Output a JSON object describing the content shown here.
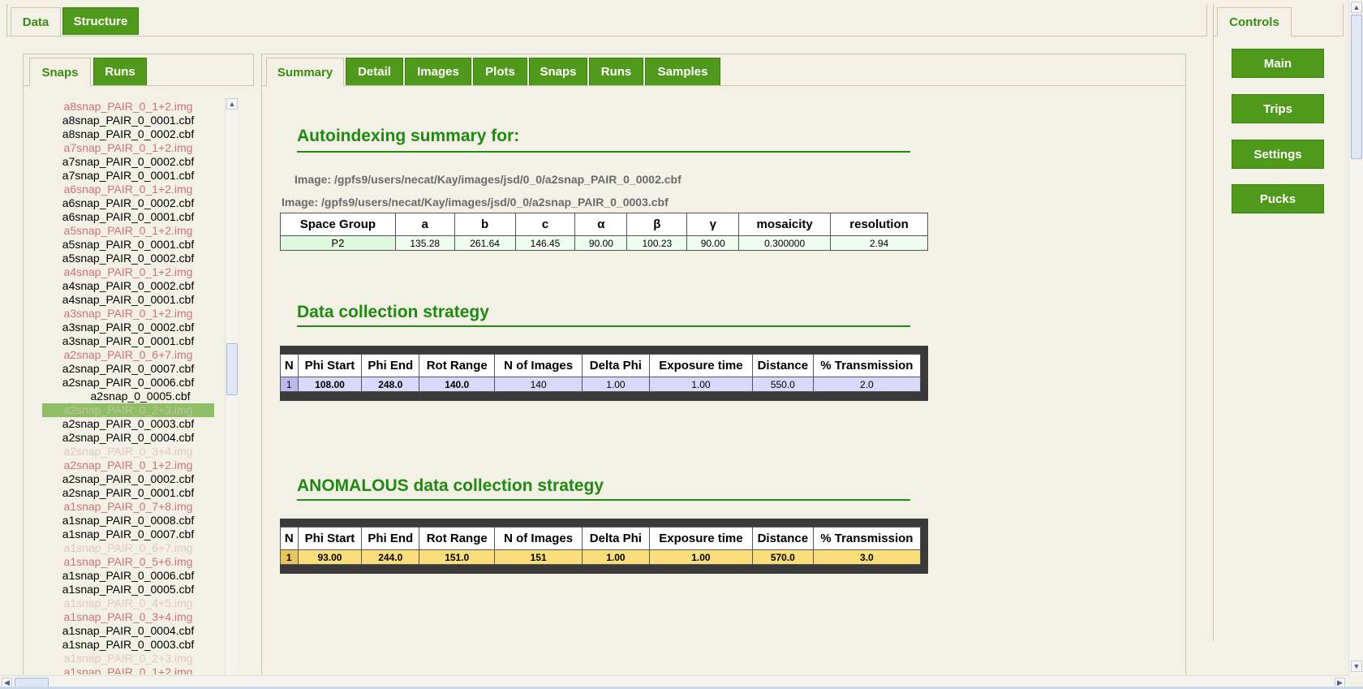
{
  "top_tabs": [
    {
      "label": "Data",
      "active": true
    },
    {
      "label": "Structure",
      "active": false
    }
  ],
  "left_tabs": [
    {
      "label": "Snaps",
      "active": true
    },
    {
      "label": "Runs",
      "active": false
    }
  ],
  "main_tabs": [
    {
      "label": "Summary",
      "active": true
    },
    {
      "label": "Detail",
      "active": false
    },
    {
      "label": "Images",
      "active": false
    },
    {
      "label": "Plots",
      "active": false
    },
    {
      "label": "Snaps",
      "active": false
    },
    {
      "label": "Runs",
      "active": false
    },
    {
      "label": "Samples",
      "active": false
    }
  ],
  "controls": {
    "tab_label": "Controls",
    "buttons": [
      "Main",
      "Trips",
      "Settings",
      "Pucks"
    ]
  },
  "snap_list": [
    {
      "name": "a8snap_PAIR_0_1+2.img",
      "style": "pink"
    },
    {
      "name": "a8snap_PAIR_0_0001.cbf",
      "style": "norm"
    },
    {
      "name": "a8snap_PAIR_0_0002.cbf",
      "style": "norm"
    },
    {
      "name": "a7snap_PAIR_0_1+2.img",
      "style": "pink"
    },
    {
      "name": "a7snap_PAIR_0_0002.cbf",
      "style": "norm"
    },
    {
      "name": "a7snap_PAIR_0_0001.cbf",
      "style": "norm"
    },
    {
      "name": "a6snap_PAIR_0_1+2.img",
      "style": "pink"
    },
    {
      "name": "a6snap_PAIR_0_0002.cbf",
      "style": "norm"
    },
    {
      "name": "a6snap_PAIR_0_0001.cbf",
      "style": "norm"
    },
    {
      "name": "a5snap_PAIR_0_1+2.img",
      "style": "pink"
    },
    {
      "name": "a5snap_PAIR_0_0001.cbf",
      "style": "norm"
    },
    {
      "name": "a5snap_PAIR_0_0002.cbf",
      "style": "norm"
    },
    {
      "name": "a4snap_PAIR_0_1+2.img",
      "style": "pink"
    },
    {
      "name": "a4snap_PAIR_0_0002.cbf",
      "style": "norm"
    },
    {
      "name": "a4snap_PAIR_0_0001.cbf",
      "style": "norm"
    },
    {
      "name": "a3snap_PAIR_0_1+2.img",
      "style": "pink"
    },
    {
      "name": "a3snap_PAIR_0_0002.cbf",
      "style": "norm"
    },
    {
      "name": "a3snap_PAIR_0_0001.cbf",
      "style": "norm"
    },
    {
      "name": "a2snap_PAIR_0_6+7.img",
      "style": "pink"
    },
    {
      "name": "a2snap_PAIR_0_0007.cbf",
      "style": "norm"
    },
    {
      "name": "a2snap_PAIR_0_0006.cbf",
      "style": "norm"
    },
    {
      "name": "a2snap_0_0005.cbf",
      "style": "indent"
    },
    {
      "name": "a2snap_PAIR_0_2+3.img",
      "style": "sel"
    },
    {
      "name": "a2snap_PAIR_0_0003.cbf",
      "style": "norm"
    },
    {
      "name": "a2snap_PAIR_0_0004.cbf",
      "style": "norm"
    },
    {
      "name": "a2snap_PAIR_0_3+4.img",
      "style": "light"
    },
    {
      "name": "a2snap_PAIR_0_1+2.img",
      "style": "pink"
    },
    {
      "name": "a2snap_PAIR_0_0002.cbf",
      "style": "norm"
    },
    {
      "name": "a2snap_PAIR_0_0001.cbf",
      "style": "norm"
    },
    {
      "name": "a1snap_PAIR_0_7+8.img",
      "style": "pink"
    },
    {
      "name": "a1snap_PAIR_0_0008.cbf",
      "style": "norm"
    },
    {
      "name": "a1snap_PAIR_0_0007.cbf",
      "style": "norm"
    },
    {
      "name": "a1snap_PAIR_0_6+7.img",
      "style": "light"
    },
    {
      "name": "a1snap_PAIR_0_5+6.img",
      "style": "pink"
    },
    {
      "name": "a1snap_PAIR_0_0006.cbf",
      "style": "norm"
    },
    {
      "name": "a1snap_PAIR_0_0005.cbf",
      "style": "norm"
    },
    {
      "name": "a1snap_PAIR_0_4+5.img",
      "style": "light"
    },
    {
      "name": "a1snap_PAIR_0_3+4.img",
      "style": "pink"
    },
    {
      "name": "a1snap_PAIR_0_0004.cbf",
      "style": "norm"
    },
    {
      "name": "a1snap_PAIR_0_0003.cbf",
      "style": "norm"
    },
    {
      "name": "a1snap_PAIR_0_2+3.img",
      "style": "light"
    },
    {
      "name": "a1snap_PAIR_0_1+2.img",
      "style": "pink"
    }
  ],
  "summary": {
    "autoindex_title": "Autoindexing summary for:",
    "image1": "Image: /gpfs9/users/necat/Kay/images/jsd/0_0/a2snap_PAIR_0_0002.cbf",
    "image2": "Image: /gpfs9/users/necat/Kay/images/jsd/0_0/a2snap_PAIR_0_0003.cbf",
    "cell_headers": [
      "Space Group",
      "a",
      "b",
      "c",
      "α",
      "β",
      "γ",
      "mosaicity",
      "resolution"
    ],
    "cell_values": [
      "P2",
      "135.28",
      "261.64",
      "146.45",
      "90.00",
      "100.23",
      "90.00",
      "0.300000",
      "2.94"
    ],
    "strategy_title": "Data collection strategy",
    "strategy_headers": [
      "N",
      "Phi Start",
      "Phi End",
      "Rot Range",
      "N of Images",
      "Delta Phi",
      "Exposure time",
      "Distance",
      "% Transmission"
    ],
    "strategy_values": [
      "1",
      "108.00",
      "248.0",
      "140.0",
      "140",
      "1.00",
      "1.00",
      "550.0",
      "2.0"
    ],
    "anom_title": "ANOMALOUS data collection strategy",
    "anom_headers": [
      "N",
      "Phi Start",
      "Phi End",
      "Rot Range",
      "N of Images",
      "Delta Phi",
      "Exposure time",
      "Distance",
      "% Transmission"
    ],
    "anom_values": [
      "1",
      "93.00",
      "244.0",
      "151.0",
      "151",
      "1.00",
      "1.00",
      "570.0",
      "3.0"
    ]
  },
  "colors": {
    "tab_green": "#4f9a1a",
    "heading_green": "#1f8a10",
    "cell_row_bg": "#dff9df",
    "strategy_row_bg": "#d8d8fb",
    "anom_row_bg": "#f9de7a"
  }
}
